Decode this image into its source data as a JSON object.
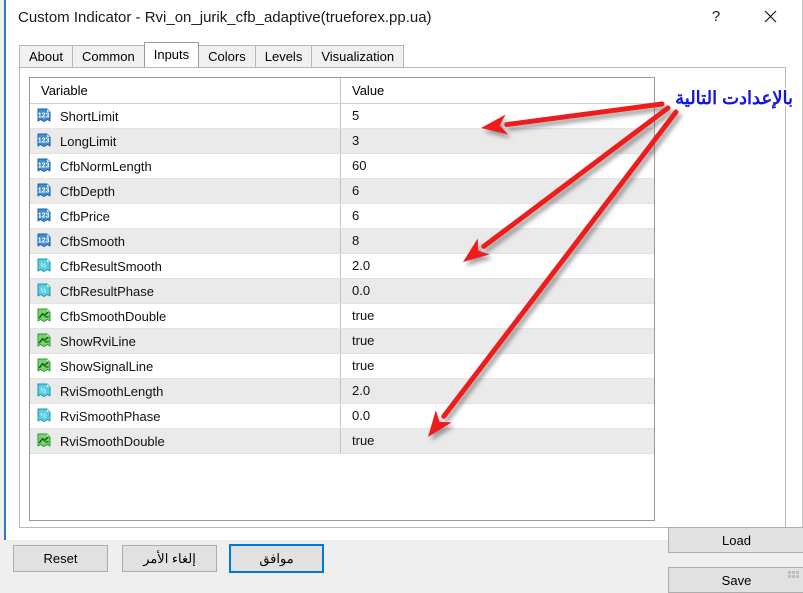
{
  "window": {
    "title": "Custom Indicator - Rvi_on_jurik_cfb_adaptive(trueforex.pp.ua)",
    "help_label": "?",
    "close_label": "✕"
  },
  "tabs": [
    {
      "label": "About",
      "active": false
    },
    {
      "label": "Common",
      "active": false
    },
    {
      "label": "Inputs",
      "active": true
    },
    {
      "label": "Colors",
      "active": false
    },
    {
      "label": "Levels",
      "active": false
    },
    {
      "label": "Visualization",
      "active": false
    }
  ],
  "grid": {
    "headers": {
      "variable": "Variable",
      "value": "Value"
    },
    "rows": [
      {
        "icon": "integer-type-icon",
        "variable": "ShortLimit",
        "value": "5"
      },
      {
        "icon": "integer-type-icon",
        "variable": "LongLimit",
        "value": "3"
      },
      {
        "icon": "integer-type-icon",
        "variable": "CfbNormLength",
        "value": "60"
      },
      {
        "icon": "integer-type-icon",
        "variable": "CfbDepth",
        "value": "6"
      },
      {
        "icon": "integer-type-icon",
        "variable": "CfbPrice",
        "value": "6"
      },
      {
        "icon": "integer-type-icon",
        "variable": "CfbSmooth",
        "value": "8"
      },
      {
        "icon": "double-type-icon",
        "variable": "CfbResultSmooth",
        "value": "2.0"
      },
      {
        "icon": "double-type-icon",
        "variable": "CfbResultPhase",
        "value": "0.0"
      },
      {
        "icon": "boolean-type-icon",
        "variable": "CfbSmoothDouble",
        "value": "true"
      },
      {
        "icon": "boolean-type-icon",
        "variable": "ShowRviLine",
        "value": "true"
      },
      {
        "icon": "boolean-type-icon",
        "variable": "ShowSignalLine",
        "value": "true"
      },
      {
        "icon": "double-type-icon",
        "variable": "RviSmoothLength",
        "value": "2.0"
      },
      {
        "icon": "double-type-icon",
        "variable": "RviSmoothPhase",
        "value": "0.0"
      },
      {
        "icon": "boolean-type-icon",
        "variable": "RviSmoothDouble",
        "value": "true"
      }
    ]
  },
  "side_buttons": {
    "load": "Load",
    "save": "Save"
  },
  "bottom_buttons": {
    "reset": "Reset",
    "cancel": "إلغاء الأمر",
    "ok": "موافق"
  },
  "annotation": {
    "text": "بالإعدادت التالية",
    "color": "#1616d8",
    "arrow_color": "#ee1c1c",
    "arrow_count": 3
  }
}
